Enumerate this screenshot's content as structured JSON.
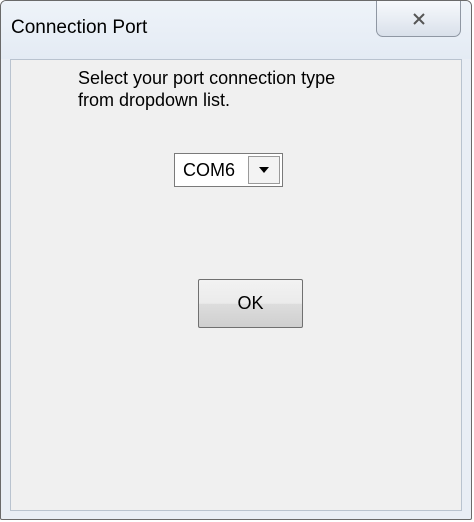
{
  "window": {
    "title": "Connection Port"
  },
  "content": {
    "instruction_line1": "Select your port connection type",
    "instruction_line2": "from dropdown list."
  },
  "port_select": {
    "selected": "COM6"
  },
  "buttons": {
    "ok_label": "OK"
  },
  "icons": {
    "close": "close-icon",
    "dropdown": "chevron-down-icon"
  }
}
